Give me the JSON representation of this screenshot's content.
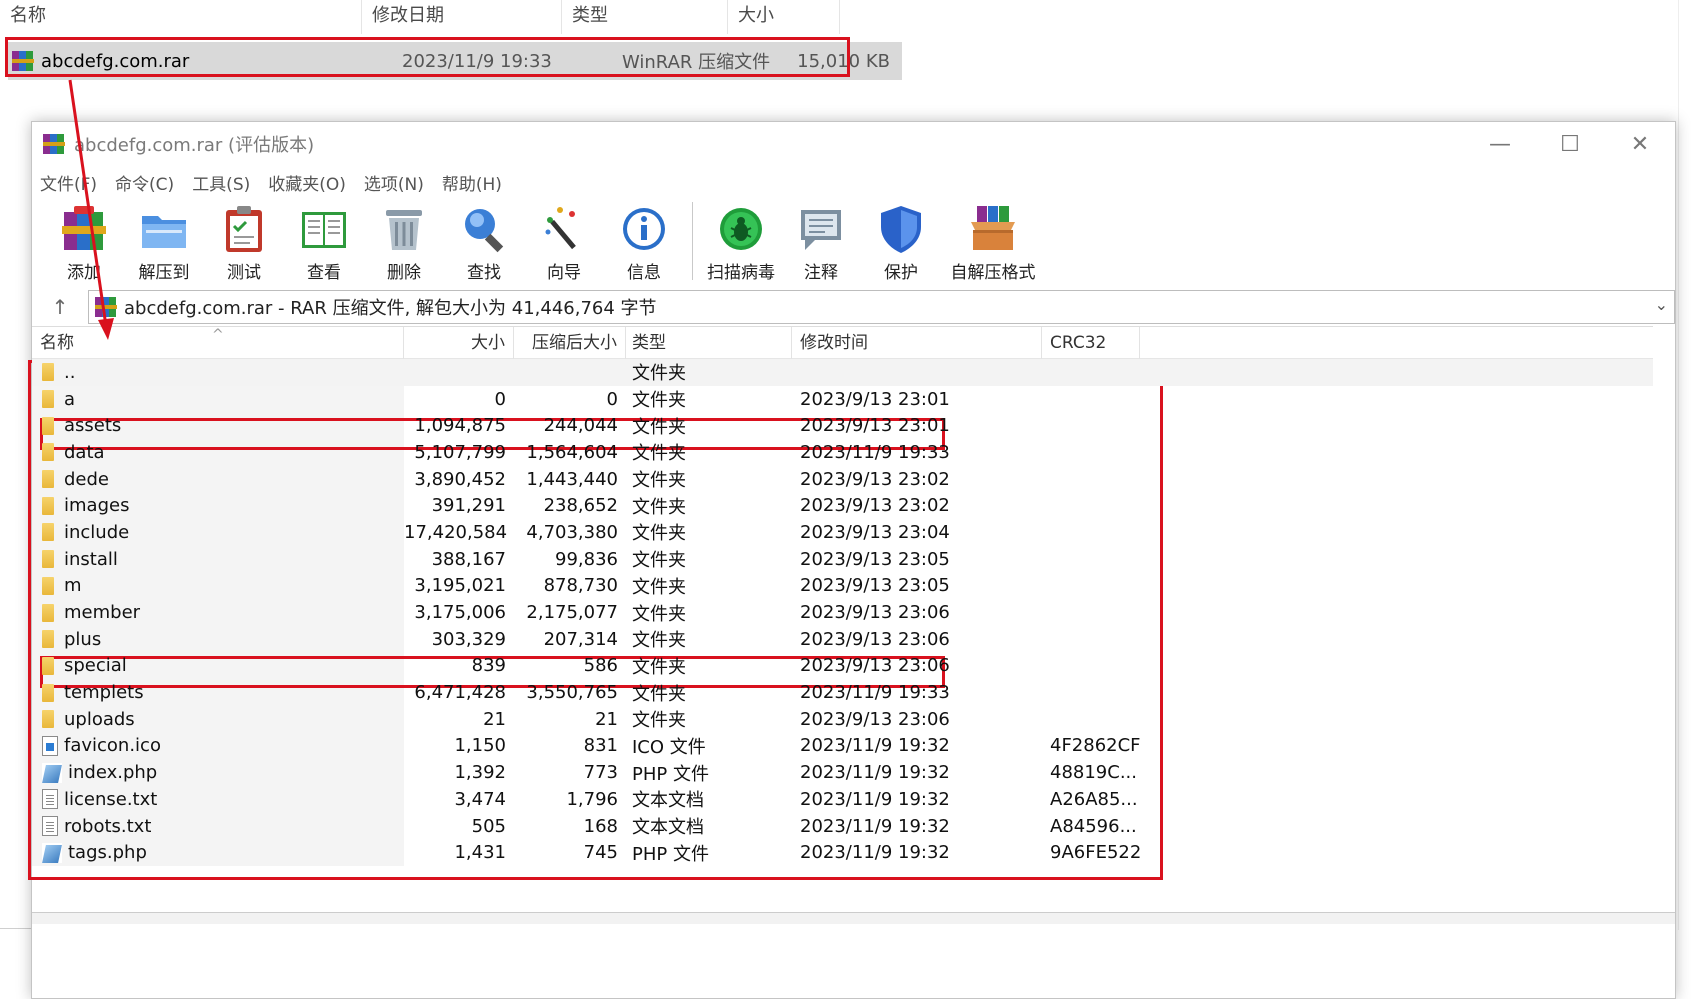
{
  "explorer": {
    "columns": [
      "名称",
      "修改日期",
      "类型",
      "大小"
    ],
    "file": {
      "name": "abcdefg.com.rar",
      "modified": "2023/11/9 19:33",
      "type": "WinRAR 压缩文件",
      "size": "15,010 KB"
    }
  },
  "window": {
    "title": "abcdefg.com.rar (评估版本)",
    "controls": {
      "minimize": "—",
      "maximize": "☐",
      "close": "✕"
    }
  },
  "menu": [
    "文件(F)",
    "命令(C)",
    "工具(S)",
    "收藏夹(O)",
    "选项(N)",
    "帮助(H)"
  ],
  "toolbar": [
    {
      "label": "添加",
      "icon": "add-archive-icon"
    },
    {
      "label": "解压到",
      "icon": "extract-folder-icon"
    },
    {
      "label": "测试",
      "icon": "test-clipboard-icon"
    },
    {
      "label": "查看",
      "icon": "view-book-icon"
    },
    {
      "label": "删除",
      "icon": "delete-trash-icon"
    },
    {
      "label": "查找",
      "icon": "find-magnifier-icon"
    },
    {
      "label": "向导",
      "icon": "wizard-wand-icon"
    },
    {
      "label": "信息",
      "icon": "info-icon"
    },
    {
      "label": "扫描病毒",
      "icon": "virus-scan-icon"
    },
    {
      "label": "注释",
      "icon": "comment-icon"
    },
    {
      "label": "保护",
      "icon": "protect-shield-icon"
    },
    {
      "label": "自解压格式",
      "icon": "sfx-box-icon"
    }
  ],
  "address": {
    "up": "↑",
    "text": "abcdefg.com.rar - RAR 压缩文件, 解包大小为 41,446,764 字节",
    "dropdown": "⌄"
  },
  "list": {
    "headers": {
      "name": "名称",
      "size": "大小",
      "packed": "压缩后大小",
      "type": "类型",
      "modified": "修改时间",
      "crc": "CRC32"
    },
    "rows": [
      {
        "kind": "folder",
        "name": "..",
        "size": "",
        "packed": "",
        "type": "文件夹",
        "modified": "",
        "crc": ""
      },
      {
        "kind": "folder",
        "name": "a",
        "size": "0",
        "packed": "0",
        "type": "文件夹",
        "modified": "2023/9/13 23:01",
        "crc": ""
      },
      {
        "kind": "folder",
        "name": "assets",
        "size": "1,094,875",
        "packed": "244,044",
        "type": "文件夹",
        "modified": "2023/9/13 23:01",
        "crc": ""
      },
      {
        "kind": "folder",
        "name": "data",
        "size": "5,107,799",
        "packed": "1,564,604",
        "type": "文件夹",
        "modified": "2023/11/9 19:33",
        "crc": ""
      },
      {
        "kind": "folder",
        "name": "dede",
        "size": "3,890,452",
        "packed": "1,443,440",
        "type": "文件夹",
        "modified": "2023/9/13 23:02",
        "crc": ""
      },
      {
        "kind": "folder",
        "name": "images",
        "size": "391,291",
        "packed": "238,652",
        "type": "文件夹",
        "modified": "2023/9/13 23:02",
        "crc": ""
      },
      {
        "kind": "folder",
        "name": "include",
        "size": "17,420,584",
        "packed": "4,703,380",
        "type": "文件夹",
        "modified": "2023/9/13 23:04",
        "crc": ""
      },
      {
        "kind": "folder",
        "name": "install",
        "size": "388,167",
        "packed": "99,836",
        "type": "文件夹",
        "modified": "2023/9/13 23:05",
        "crc": ""
      },
      {
        "kind": "folder",
        "name": "m",
        "size": "3,195,021",
        "packed": "878,730",
        "type": "文件夹",
        "modified": "2023/9/13 23:05",
        "crc": ""
      },
      {
        "kind": "folder",
        "name": "member",
        "size": "3,175,006",
        "packed": "2,175,077",
        "type": "文件夹",
        "modified": "2023/9/13 23:06",
        "crc": ""
      },
      {
        "kind": "folder",
        "name": "plus",
        "size": "303,329",
        "packed": "207,314",
        "type": "文件夹",
        "modified": "2023/9/13 23:06",
        "crc": ""
      },
      {
        "kind": "folder",
        "name": "special",
        "size": "839",
        "packed": "586",
        "type": "文件夹",
        "modified": "2023/9/13 23:06",
        "crc": ""
      },
      {
        "kind": "folder",
        "name": "templets",
        "size": "6,471,428",
        "packed": "3,550,765",
        "type": "文件夹",
        "modified": "2023/11/9 19:33",
        "crc": ""
      },
      {
        "kind": "folder",
        "name": "uploads",
        "size": "21",
        "packed": "21",
        "type": "文件夹",
        "modified": "2023/9/13 23:06",
        "crc": ""
      },
      {
        "kind": "ico",
        "name": "favicon.ico",
        "size": "1,150",
        "packed": "831",
        "type": "ICO 文件",
        "modified": "2023/11/9 19:32",
        "crc": "4F2862CF"
      },
      {
        "kind": "php",
        "name": "index.php",
        "size": "1,392",
        "packed": "773",
        "type": "PHP 文件",
        "modified": "2023/11/9 19:32",
        "crc": "48819C..."
      },
      {
        "kind": "txt",
        "name": "license.txt",
        "size": "3,474",
        "packed": "1,796",
        "type": "文本文档",
        "modified": "2023/11/9 19:32",
        "crc": "A26A85..."
      },
      {
        "kind": "txt",
        "name": "robots.txt",
        "size": "505",
        "packed": "168",
        "type": "文本文档",
        "modified": "2023/11/9 19:32",
        "crc": "A84596..."
      },
      {
        "kind": "php",
        "name": "tags.php",
        "size": "1,431",
        "packed": "745",
        "type": "PHP 文件",
        "modified": "2023/11/9 19:32",
        "crc": "9A6FE522"
      }
    ]
  },
  "annotation_color": "#d9111e"
}
